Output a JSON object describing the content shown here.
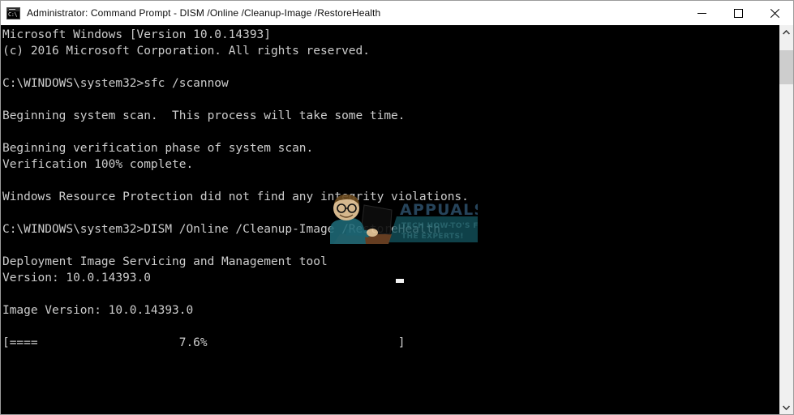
{
  "window": {
    "title": "Administrator: Command Prompt - DISM  /Online /Cleanup-Image /RestoreHealth",
    "icon_name": "command-prompt-icon",
    "icon_glyph": "C:\\",
    "background_color": "#000000",
    "titlebar_color": "#ffffff",
    "text_color": "#cccccc"
  },
  "caption": {
    "minimize_label": "Minimize",
    "maximize_label": "Maximize",
    "close_label": "Close"
  },
  "console": {
    "lines": [
      "Microsoft Windows [Version 10.0.14393]",
      "(c) 2016 Microsoft Corporation. All rights reserved.",
      "",
      "C:\\WINDOWS\\system32>sfc /scannow",
      "",
      "Beginning system scan.  This process will take some time.",
      "",
      "Beginning verification phase of system scan.",
      "Verification 100% complete.",
      "",
      "Windows Resource Protection did not find any integrity violations.",
      "",
      "C:\\WINDOWS\\system32>DISM /Online /Cleanup-Image /RestoreHealth",
      "",
      "Deployment Image Servicing and Management tool",
      "Version: 10.0.14393.0",
      "",
      "Image Version: 10.0.14393.0",
      "",
      "[====                    7.6%                           ]"
    ],
    "full_text": "Microsoft Windows [Version 10.0.14393]\n(c) 2016 Microsoft Corporation. All rights reserved.\n\nC:\\WINDOWS\\system32>sfc /scannow\n\nBeginning system scan.  This process will take some time.\n\nBeginning verification phase of system scan.\nVerification 100% complete.\n\nWindows Resource Protection did not find any integrity violations.\n\nC:\\WINDOWS\\system32>DISM /Online /Cleanup-Image /RestoreHealth\n\nDeployment Image Servicing and Management tool\nVersion: 10.0.14393.0\n\nImage Version: 10.0.14393.0\n\n[====                    7.6%                           ]",
    "commands": [
      "sfc /scannow",
      "DISM /Online /Cleanup-Image /RestoreHealth"
    ],
    "prompt": "C:\\WINDOWS\\system32>",
    "os_version": "10.0.14393",
    "copyright_year": "2016",
    "verification_percent": "100%",
    "progress_percent": "7.6%",
    "progress_filled_chars": 4,
    "dism_tool_name": "Deployment Image Servicing and Management tool",
    "dism_version": "10.0.14393.0",
    "image_version": "10.0.14393.0"
  },
  "watermark": {
    "brand": "APPUALS",
    "tagline_line1": "TECH HOW-TO'S FROM",
    "tagline_line2": "THE EXPERTS!",
    "brand_color": "#2a4a63",
    "band_color": "#1b5c66"
  },
  "scrollbar": {
    "up_arrow_name": "scroll-up-arrow",
    "down_arrow_name": "scroll-down-arrow",
    "thumb_name": "scrollbar-thumb"
  }
}
